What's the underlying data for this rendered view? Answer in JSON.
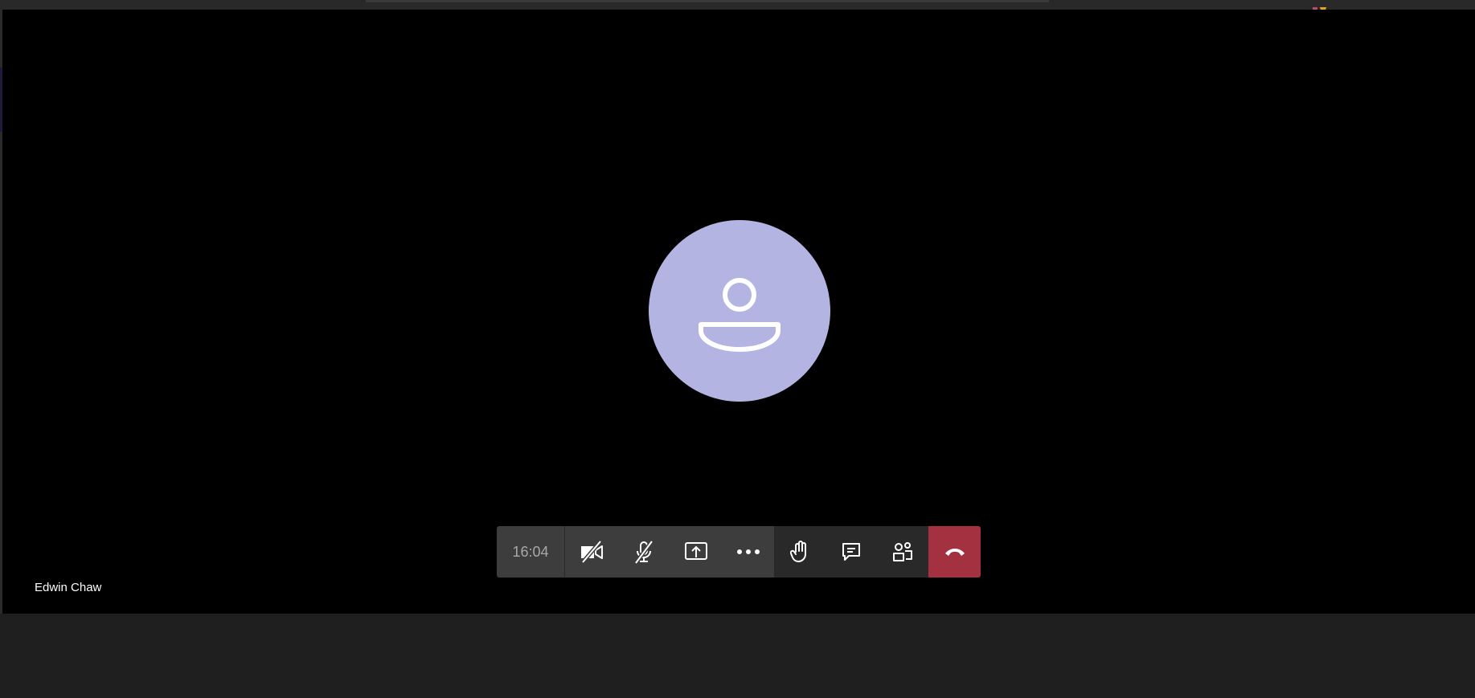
{
  "call": {
    "participant_name": "Edwin Chaw",
    "duration": "16:04"
  },
  "controls": [
    {
      "id": "camera",
      "icon": "camera-off-icon",
      "state": "off"
    },
    {
      "id": "microphone",
      "icon": "mic-off-icon",
      "state": "muted"
    },
    {
      "id": "share",
      "icon": "share-screen-icon"
    },
    {
      "id": "more",
      "icon": "more-actions-icon"
    },
    {
      "id": "raise-hand",
      "icon": "raise-hand-icon"
    },
    {
      "id": "chat",
      "icon": "chat-icon"
    },
    {
      "id": "participants",
      "icon": "participants-icon"
    },
    {
      "id": "hang-up",
      "icon": "hang-up-icon"
    }
  ],
  "colors": {
    "stage": "#000000",
    "avatar": "#b4b4e3",
    "hangup": "#a4313f",
    "control_bar": "#3d3d3d",
    "control_bar_dark": "#292929"
  }
}
